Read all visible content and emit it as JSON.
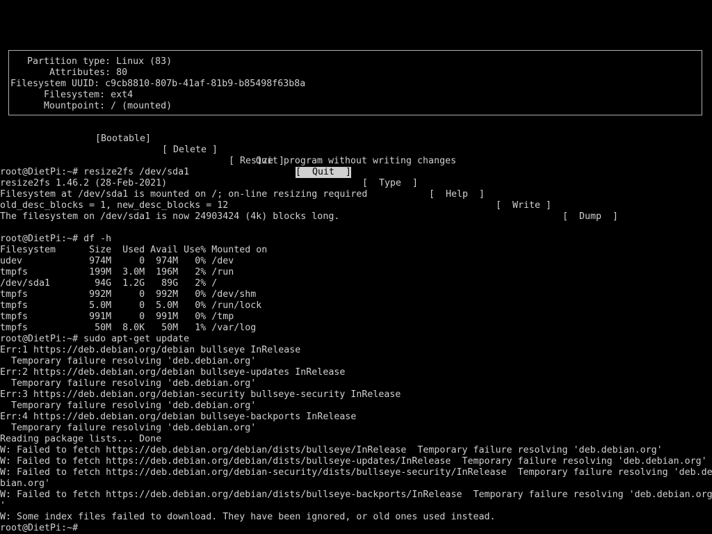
{
  "partition_info": {
    "rows": [
      "  Partition type: Linux (83)",
      "      Attributes: 80",
      "Filesystem UUID: c9cb8810-807b-41af-81b9-b85498f63b8a",
      "      Filesystem: ext4",
      "      Mountpoint: / (mounted)"
    ]
  },
  "menu": {
    "items": [
      {
        "label": "[Bootable]",
        "selected": false
      },
      {
        "label": "[ Delete ]",
        "selected": false
      },
      {
        "label": "[ Resize ]",
        "selected": false
      },
      {
        "label": "[  Quit  ]",
        "selected": true
      },
      {
        "label": "[  Type  ]",
        "selected": false
      },
      {
        "label": "[  Help  ]",
        "selected": false
      },
      {
        "label": "[  Write ]",
        "selected": false
      },
      {
        "label": "[  Dump  ]",
        "selected": false
      }
    ]
  },
  "status_message": "Quit program without writing changes",
  "terminal": {
    "lines": [
      "root@DietPi:~# resize2fs /dev/sda1",
      "resize2fs 1.46.2 (28-Feb-2021)",
      "Filesystem at /dev/sda1 is mounted on /; on-line resizing required",
      "old_desc_blocks = 1, new_desc_blocks = 12",
      "The filesystem on /dev/sda1 is now 24903424 (4k) blocks long.",
      "",
      "root@DietPi:~# df -h",
      "Filesystem      Size  Used Avail Use% Mounted on",
      "udev            974M     0  974M   0% /dev",
      "tmpfs           199M  3.0M  196M   2% /run",
      "/dev/sda1        94G  1.2G   89G   2% /",
      "tmpfs           992M     0  992M   0% /dev/shm",
      "tmpfs           5.0M     0  5.0M   0% /run/lock",
      "tmpfs           991M     0  991M   0% /tmp",
      "tmpfs            50M  8.0K   50M   1% /var/log",
      "root@DietPi:~# sudo apt-get update",
      "Err:1 https://deb.debian.org/debian bullseye InRelease",
      "  Temporary failure resolving 'deb.debian.org'",
      "Err:2 https://deb.debian.org/debian bullseye-updates InRelease",
      "  Temporary failure resolving 'deb.debian.org'",
      "Err:3 https://deb.debian.org/debian-security bullseye-security InRelease",
      "  Temporary failure resolving 'deb.debian.org'",
      "Err:4 https://deb.debian.org/debian bullseye-backports InRelease",
      "  Temporary failure resolving 'deb.debian.org'",
      "Reading package lists... Done",
      "W: Failed to fetch https://deb.debian.org/debian/dists/bullseye/InRelease  Temporary failure resolving 'deb.debian.org'",
      "W: Failed to fetch https://deb.debian.org/debian/dists/bullseye-updates/InRelease  Temporary failure resolving 'deb.debian.org'",
      "W: Failed to fetch https://deb.debian.org/debian-security/dists/bullseye-security/InRelease  Temporary failure resolving 'deb.de",
      "bian.org'",
      "W: Failed to fetch https://deb.debian.org/debian/dists/bullseye-backports/InRelease  Temporary failure resolving 'deb.debian.org",
      "'",
      "W: Some index files failed to download. They have been ignored, or old ones used instead.",
      "root@DietPi:~#"
    ]
  }
}
